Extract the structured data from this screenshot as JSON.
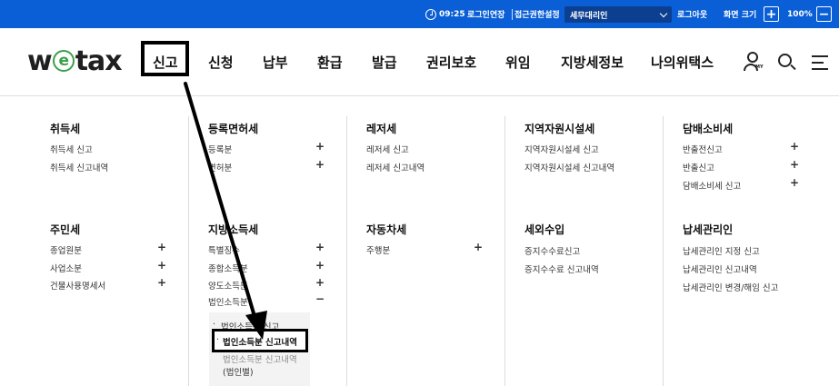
{
  "topbar": {
    "time": "09:25",
    "extend_label": "로그인연장",
    "auth_label": "접근권한설정",
    "role_selected": "세무대리인",
    "logout_label": "로그아웃",
    "zoom_label": "화면 크기",
    "zoom_plus": "+",
    "zoom_value": "100%",
    "zoom_minus": "−"
  },
  "logo": {
    "part1": "w",
    "e": "e",
    "part2": "tax"
  },
  "nav": [
    "신고",
    "신청",
    "납부",
    "환급",
    "발급",
    "권리보호",
    "위임",
    "지방세정보",
    "나의위택스"
  ],
  "user_icon_badge": "MY",
  "mega": {
    "col1": {
      "cat1": "취득세",
      "cat1_items": [
        "취득세 신고",
        "취득세 신고내역"
      ],
      "cat2": "주민세",
      "cat2_items": [
        "종업원분",
        "사업소분",
        "건물사용명세서"
      ]
    },
    "col2": {
      "cat1": "등록면허세",
      "cat1_items": [
        "등록분",
        "면허분"
      ],
      "cat2": "지방소득세",
      "cat2_items": [
        "특별징수",
        "종합소득분",
        "양도소득분",
        "법인소득분"
      ],
      "sub_items": [
        "법인소득분 신고",
        "법인소득분 신고내역",
        "법인소득분 신고내역",
        "(법인별)"
      ]
    },
    "col3": {
      "cat1": "레저세",
      "cat1_items": [
        "레저세 신고",
        "레저세 신고내역"
      ],
      "cat2": "자동차세",
      "cat2_items": [
        "주행분"
      ]
    },
    "col4": {
      "cat1": "지역자원시설세",
      "cat1_items": [
        "지역자원시설세 신고",
        "지역자원시설세 신고내역"
      ],
      "cat2": "세외수입",
      "cat2_items": [
        "증지수수료신고",
        "증지수수료 신고내역"
      ]
    },
    "col5": {
      "cat1": "담배소비세",
      "cat1_items": [
        "반출전신고",
        "반출신고",
        "담배소비세 신고"
      ],
      "cat2": "납세관리인",
      "cat2_items": [
        "납세관리인 지정 신고",
        "납세관리인 신고내역",
        "납세관리인 변경/해임 신고"
      ]
    },
    "plus": "+",
    "minus": "−",
    "bullet": "·"
  }
}
